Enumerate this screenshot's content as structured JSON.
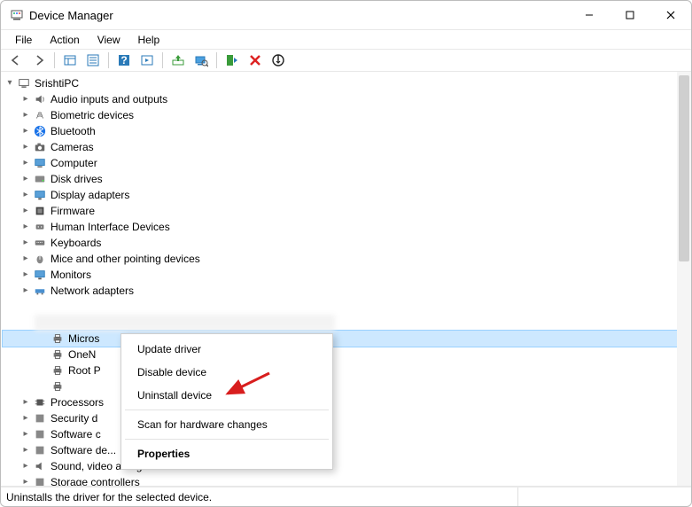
{
  "title": "Device Manager",
  "menus": {
    "file": "File",
    "action": "Action",
    "view": "View",
    "help": "Help"
  },
  "root": "SrishtiPC",
  "categories": [
    "Audio inputs and outputs",
    "Biometric devices",
    "Bluetooth",
    "Cameras",
    "Computer",
    "Disk drives",
    "Display adapters",
    "Firmware",
    "Human Interface Devices",
    "Keyboards",
    "Mice and other pointing devices",
    "Monitors",
    "Network adapters"
  ],
  "printers": {
    "selected": "Micros",
    "items": [
      "Micros",
      "OneN",
      "Root P"
    ]
  },
  "tail": [
    "Processors",
    "Security d",
    "Software c",
    "Software de...",
    "Sound, video and game controllers",
    "Storage controllers"
  ],
  "context": {
    "update": "Update driver",
    "disable": "Disable device",
    "uninstall": "Uninstall device",
    "scan": "Scan for hardware changes",
    "properties": "Properties"
  },
  "status": "Uninstalls the driver for the selected device."
}
